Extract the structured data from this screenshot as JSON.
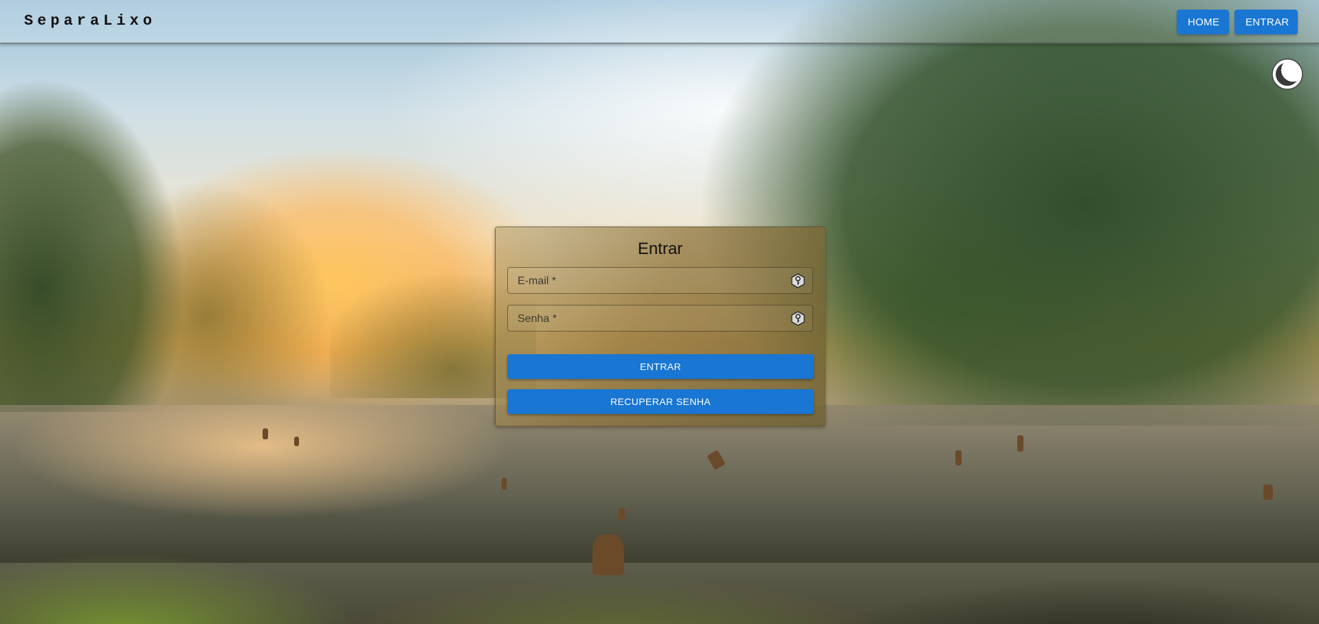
{
  "header": {
    "brand": "SeparaLixo",
    "nav": {
      "home_label": "HOME",
      "login_label": "ENTRAR"
    }
  },
  "theme_toggle": {
    "icon": "moon-icon"
  },
  "login_card": {
    "title": "Entrar",
    "email_field": {
      "placeholder": "E-mail *",
      "value": "",
      "icon": "key-icon"
    },
    "password_field": {
      "placeholder": "Senha *",
      "value": "",
      "icon": "key-icon"
    },
    "submit_label": "ENTRAR",
    "recover_label": "RECUPERAR SENHA"
  },
  "colors": {
    "primary": "#1976d2"
  }
}
